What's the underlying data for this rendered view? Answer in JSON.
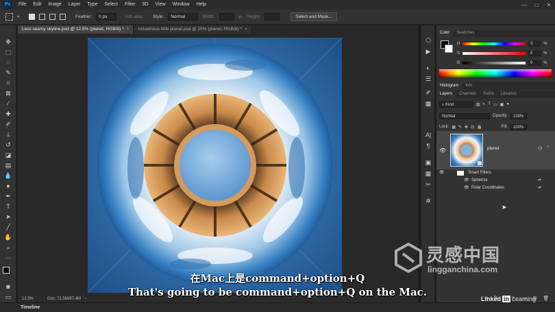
{
  "menubar": {
    "logo": "Ps",
    "items": [
      "File",
      "Edit",
      "Image",
      "Layer",
      "Type",
      "Select",
      "Filter",
      "3D",
      "View",
      "Window",
      "Help"
    ],
    "window_controls": [
      "—",
      "□",
      "✕"
    ]
  },
  "options_bar": {
    "feather_label": "Feather:",
    "feather_value": "0 px",
    "antialias_label": "Anti-alias",
    "style_label": "Style:",
    "style_value": "Normal",
    "width_label": "Width:",
    "height_label": "Height:",
    "select_mask_button": "Select and Mask..."
  },
  "doc_tabs": [
    {
      "label": "Less seamy skyline.psd @ 12.5% (planet, RGB/8) *",
      "active": true
    },
    {
      "label": "Industrious little planet.psd @ 25% (planet, RGB/8) *",
      "active": false
    }
  ],
  "status_bar": {
    "zoom": "12.5%",
    "doc_size": "Doc: 71.5M/87.4M"
  },
  "timeline_label": "Timeline",
  "color_panel": {
    "tabs": [
      "Color",
      "Swatches"
    ],
    "sliders": [
      {
        "label": "H",
        "value": "0"
      },
      {
        "label": "S",
        "value": "0"
      },
      {
        "label": "B",
        "value": "0"
      }
    ],
    "unit": "%"
  },
  "middle_tabs": [
    "Histogram",
    "Info"
  ],
  "layers_panel": {
    "tabs": [
      "Layers",
      "Channels",
      "Paths",
      "Libraries"
    ],
    "filter_kind": "Kind",
    "blend_mode": "Normal",
    "opacity_label": "Opacity:",
    "opacity_value": "100%",
    "lock_label": "Lock:",
    "fill_label": "Fill:",
    "fill_value": "100%",
    "layer_name": "planet",
    "smart_filters_label": "Smart Filters",
    "filters": [
      "Spherize",
      "Polar Coordinates"
    ]
  },
  "subtitle": {
    "chinese": "在Mac上是command+option+Q",
    "english": "That's going to be command+option+Q on the Mac."
  },
  "watermark": {
    "brand_cn": "灵感中国",
    "brand_url": "lingganchina.com"
  },
  "linkedin": {
    "linked": "Linked",
    "in": "in",
    "learning": "Learning"
  },
  "colors": {
    "ui_bg": "#323232",
    "canvas_bg": "#282828",
    "accent_blue": "#31a8ff",
    "selected_layer": "#474747"
  }
}
